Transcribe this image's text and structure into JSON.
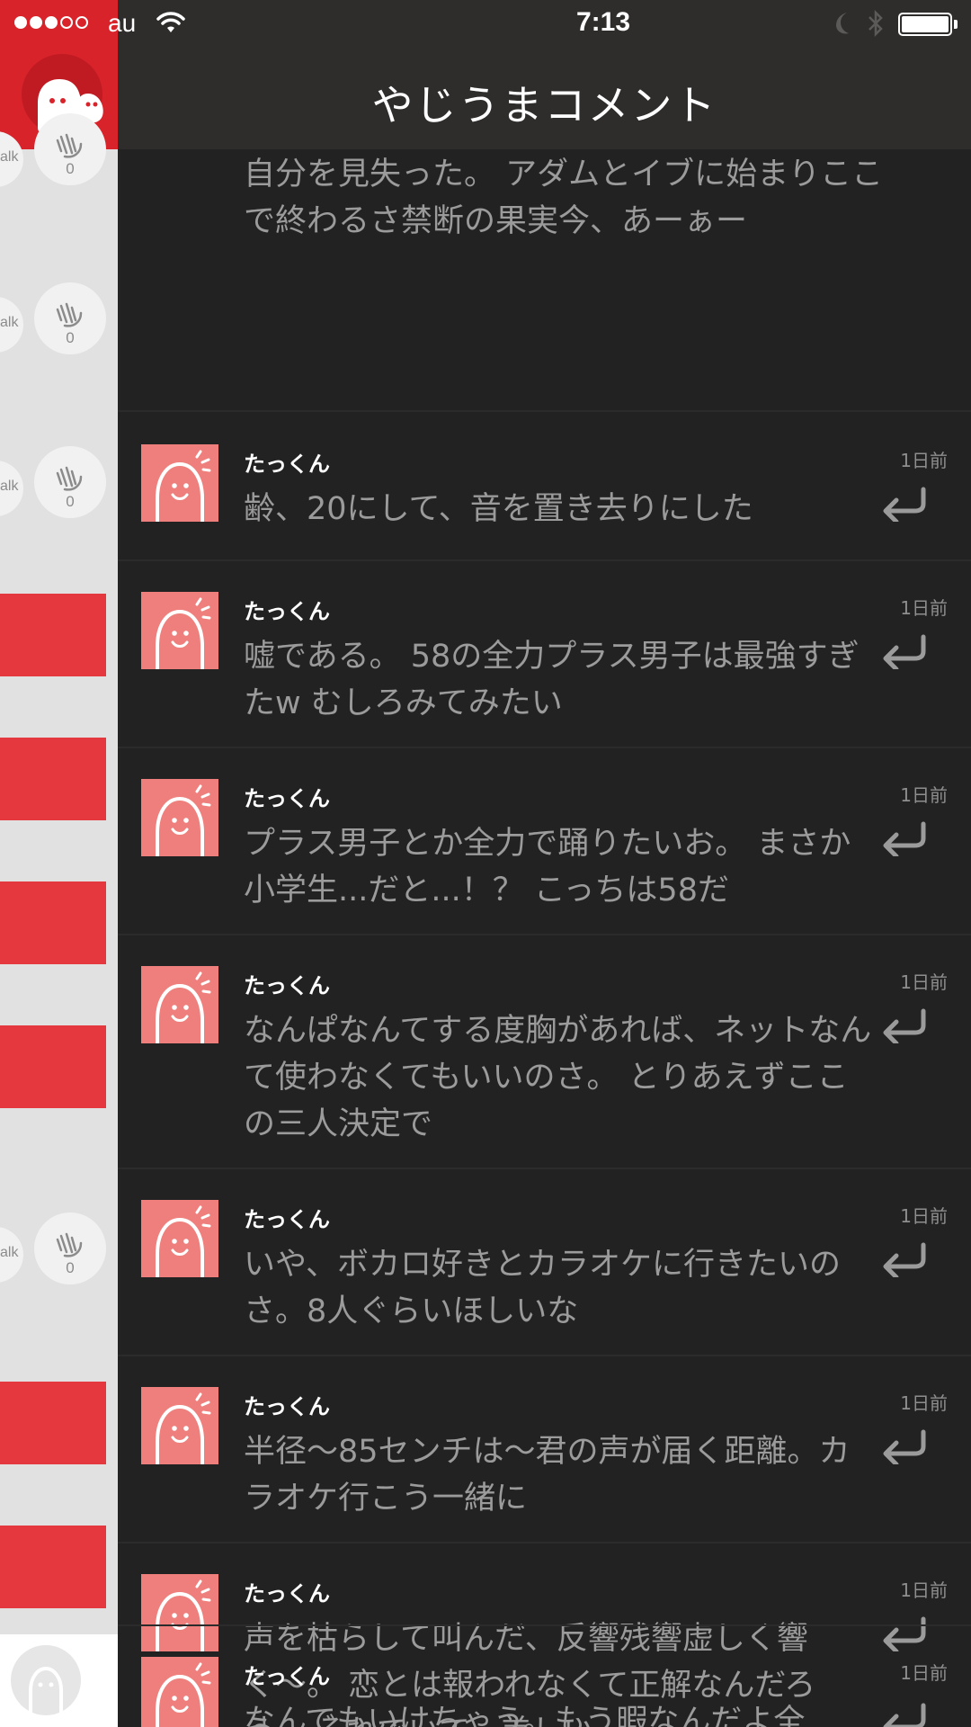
{
  "status_bar": {
    "carrier": "au",
    "time": "7:13"
  },
  "header": {
    "title": "やじうまコメント"
  },
  "sidebar": {
    "talk_label": "alk",
    "clap_count": "0"
  },
  "partial_comment": {
    "text": "自分を見失った。 アダムとイブに始まりここで終わるさ禁断の果実今、あーぁー"
  },
  "comments": [
    {
      "user": "たっくん",
      "time": "1日前",
      "text": "齢、20にして、音を置き去りにした"
    },
    {
      "user": "たっくん",
      "time": "1日前",
      "text": "嘘である。 58の全力プラス男子は最強すぎたw むしろみてみたい"
    },
    {
      "user": "たっくん",
      "time": "1日前",
      "text": "プラス男子とか全力で踊りたいお。 まさか小学生...だと...！？ こっちは58だ"
    },
    {
      "user": "たっくん",
      "time": "1日前",
      "text": "なんぱなんてする度胸があれば、ネットなんて使わなくてもいいのさ。 とりあえずここの三人決定で"
    },
    {
      "user": "たっくん",
      "time": "1日前",
      "text": "いや、ボカロ好きとカラオケに行きたいのさ。8人ぐらいほしいな"
    },
    {
      "user": "たっくん",
      "time": "1日前",
      "text": "半径〜85センチは〜君の声が届く距離。カラオケ行こう一緒に"
    },
    {
      "user": "たっくん",
      "time": "1日前",
      "text": "声を枯らして叫んだ、反響残響虚しく響く〜。 恋とは報われなくて正解なんだろう。 それでいて、美しい"
    },
    {
      "user": "たっくん",
      "time": "1日前",
      "text": "なんでもいけちゃう。もう暇なんだよ全"
    }
  ]
}
